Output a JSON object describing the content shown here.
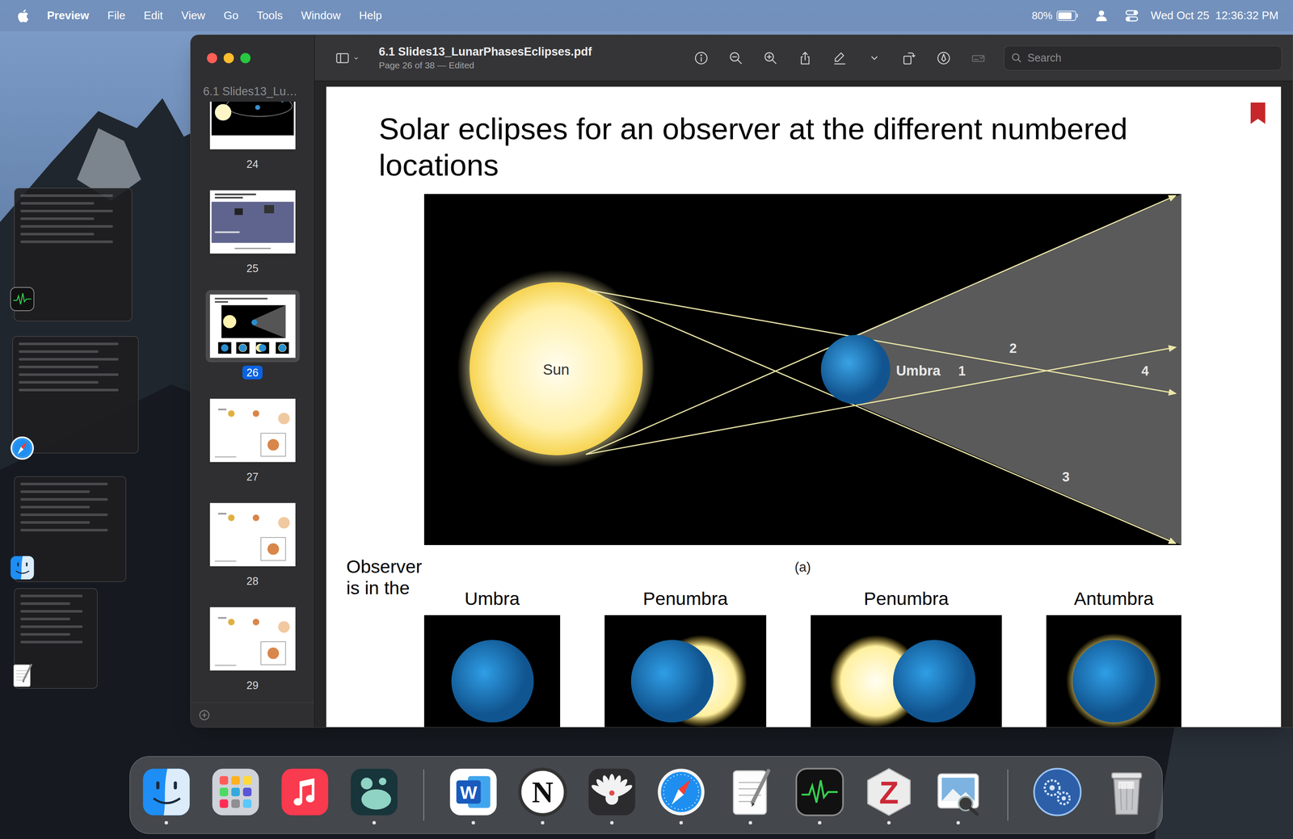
{
  "menubar": {
    "app": "Preview",
    "items": [
      "File",
      "Edit",
      "View",
      "Go",
      "Tools",
      "Window",
      "Help"
    ],
    "battery": {
      "reading": "80%",
      "level": 0.8
    },
    "clock": "Wed Oct 25  12:36:32 PM"
  },
  "stage_manager": [
    {
      "kind": "activity-monitor"
    },
    {
      "kind": "safari"
    },
    {
      "kind": "finder"
    },
    {
      "kind": "textedit"
    }
  ],
  "window": {
    "title": "6.1 Slides13_LunarPhasesEclipses.pdf",
    "subtitle": "Page 26 of 38 — Edited",
    "search": {
      "placeholder": "Search"
    },
    "toolbar": [
      {
        "kind": "info",
        "disabled": false
      },
      {
        "kind": "zoom-out",
        "disabled": false
      },
      {
        "kind": "zoom-in",
        "disabled": false
      },
      {
        "kind": "share",
        "disabled": false
      },
      {
        "kind": "highlight",
        "disabled": false
      },
      {
        "kind": "chevron",
        "disabled": false
      },
      {
        "kind": "rotate",
        "disabled": false
      },
      {
        "kind": "markup",
        "disabled": false
      },
      {
        "kind": "form",
        "disabled": true
      }
    ]
  },
  "sidebar": {
    "header": "6.1 Slides13_Lu…",
    "pages": [
      {
        "label": "24",
        "kind": "dark-image",
        "selected": false
      },
      {
        "label": "25",
        "kind": "image-slide",
        "selected": false
      },
      {
        "label": "26",
        "kind": "diagram-slide",
        "selected": true
      },
      {
        "label": "27",
        "kind": "sketch-slide",
        "selected": false
      },
      {
        "label": "28",
        "kind": "sketch-slide",
        "selected": false
      },
      {
        "label": "29",
        "kind": "sketch-slide",
        "selected": false
      }
    ]
  },
  "page": {
    "title": "Solar eclipses for an observer at the different numbered locations",
    "bookmarked": true,
    "diagram": {
      "sun": "Sun",
      "umbra": "Umbra",
      "points": [
        "1",
        "2",
        "3",
        "4"
      ],
      "caption": "(a)"
    },
    "observer_label": "Observer is in the",
    "views": [
      {
        "label": "Umbra",
        "kind": "umbra"
      },
      {
        "label": "Penumbra",
        "kind": "penumbra-right"
      },
      {
        "label": "Penumbra",
        "kind": "penumbra-left"
      },
      {
        "label": "Antumbra",
        "kind": "antumbra"
      }
    ]
  },
  "dock": {
    "sections": [
      [
        {
          "kind": "finder",
          "running": true
        },
        {
          "kind": "launchpad",
          "running": false
        },
        {
          "kind": "music",
          "running": false
        },
        {
          "kind": "teal-app",
          "running": true
        }
      ],
      [
        {
          "kind": "word",
          "glyph": "W",
          "running": true
        },
        {
          "kind": "notion",
          "glyph": "N",
          "running": true
        },
        {
          "kind": "bird",
          "running": true
        },
        {
          "kind": "safari",
          "running": true
        },
        {
          "kind": "textedit",
          "running": true
        },
        {
          "kind": "activity-monitor",
          "running": true
        },
        {
          "kind": "zotero",
          "glyph": "Z",
          "running": true
        },
        {
          "kind": "preview",
          "running": true
        }
      ],
      [
        {
          "kind": "globe",
          "running": false
        },
        {
          "kind": "trash",
          "running": false
        }
      ]
    ]
  }
}
